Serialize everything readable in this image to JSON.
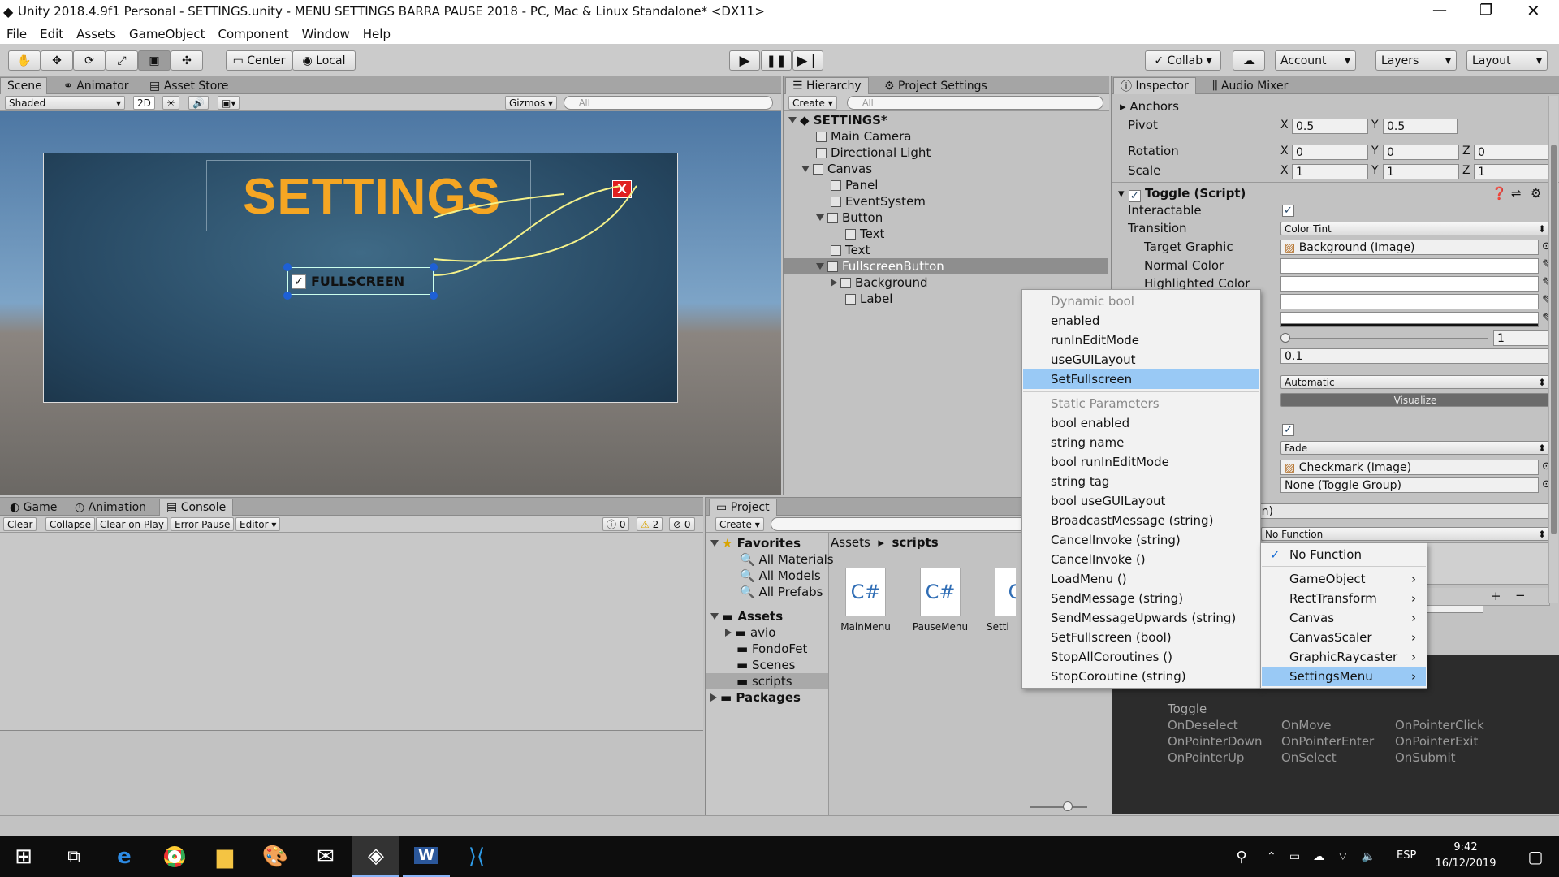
{
  "window": {
    "title": "Unity 2018.4.9f1 Personal - SETTINGS.unity - MENU SETTINGS BARRA PAUSE 2018 - PC, Mac & Linux Standalone* <DX11>"
  },
  "menu": [
    "File",
    "Edit",
    "Assets",
    "GameObject",
    "Component",
    "Window",
    "Help"
  ],
  "toolbar": {
    "center": "Center",
    "local": "Local",
    "collab": "Collab",
    "account": "Account",
    "layers": "Layers",
    "layout": "Layout"
  },
  "scene": {
    "tabs": [
      "Scene",
      "Animator",
      "Asset Store"
    ],
    "shading": "Shaded",
    "mode2d": "2D",
    "gizmos": "Gizmos",
    "search": "All",
    "canvas_title": "SETTINGS",
    "close_label": "X",
    "toggle_label": "FULLSCREEN"
  },
  "hierarchy": {
    "tabs": [
      "Hierarchy",
      "Project Settings"
    ],
    "create": "Create",
    "search": "All",
    "root": "SETTINGS*",
    "items": [
      {
        "label": "Main Camera"
      },
      {
        "label": "Directional Light"
      },
      {
        "label": "Canvas"
      },
      {
        "label": "Panel"
      },
      {
        "label": "EventSystem"
      },
      {
        "label": "Button"
      },
      {
        "label": "Text"
      },
      {
        "label": "Text"
      },
      {
        "label": "FullscreenButton"
      },
      {
        "label": "Background"
      },
      {
        "label": "Label"
      }
    ]
  },
  "inspector": {
    "tabs": [
      "Inspector",
      "Audio Mixer"
    ],
    "anchors": "Anchors",
    "pivot": "Pivot",
    "rotation": "Rotation",
    "scale": "Scale",
    "pivot_x": "0.5",
    "pivot_y": "0.5",
    "rot_x": "0",
    "rot_y": "0",
    "rot_z": "0",
    "scale_x": "1",
    "scale_y": "1",
    "scale_z": "1",
    "component": "Toggle (Script)",
    "interactable": "Interactable",
    "transition": "Transition",
    "transition_value": "Color Tint",
    "target_graphic": "Target Graphic",
    "target_graphic_value": "Background (Image)",
    "normal_color": "Normal Color",
    "highlighted_color": "Highlighted Color",
    "color_multiplier": "1",
    "fade_duration": "0.1",
    "navigation": "Automatic",
    "visualize": "Visualize",
    "toggle_transition": "Fade",
    "graphic": "Checkmark (Image)",
    "group": "None (Toggle Group)",
    "on_value_changed": "olean)",
    "no_function": "No Function",
    "events_title": "Toggle",
    "events": [
      "OnDeselect",
      "OnMove",
      "OnPointerClick",
      "OnPointerDown",
      "OnPointerEnter",
      "OnPointerExit",
      "OnPointerUp",
      "OnSelect",
      "OnSubmit"
    ]
  },
  "bottom_left": {
    "tabs": [
      "Game",
      "Animation",
      "Console"
    ],
    "buttons": [
      "Clear",
      "Collapse",
      "Clear on Play",
      "Error Pause",
      "Editor"
    ],
    "counts": {
      "info": "0",
      "warn": "2",
      "error": "0"
    }
  },
  "project": {
    "tab": "Project",
    "create": "Create",
    "favorites": "Favorites",
    "fav_items": [
      "All Materials",
      "All Models",
      "All Prefabs"
    ],
    "assets": "Assets",
    "asset_items": [
      "avio",
      "FondoFet",
      "Scenes",
      "scripts"
    ],
    "packages": "Packages",
    "breadcrumb": [
      "Assets",
      "scripts"
    ],
    "files": [
      {
        "icon": "C#",
        "name": "MainMenu"
      },
      {
        "icon": "C#",
        "name": "PauseMenu"
      },
      {
        "icon": "C",
        "name": "Setti"
      }
    ]
  },
  "function_menu": {
    "header_dynamic": "Dynamic bool",
    "dynamic": [
      "enabled",
      "runInEditMode",
      "useGUILayout",
      "SetFullscreen"
    ],
    "header_static": "Static Parameters",
    "static": [
      "bool enabled",
      "string name",
      "bool runInEditMode",
      "string tag",
      "bool useGUILayout",
      "BroadcastMessage (string)",
      "CancelInvoke (string)",
      "CancelInvoke ()",
      "LoadMenu ()",
      "SendMessage (string)",
      "SendMessageUpwards (string)",
      "SetFullscreen (bool)",
      "StopAllCoroutines ()",
      "StopCoroutine (string)"
    ]
  },
  "object_menu": {
    "items": [
      "No Function",
      "GameObject",
      "RectTransform",
      "Canvas",
      "CanvasScaler",
      "GraphicRaycaster",
      "SettingsMenu"
    ]
  },
  "taskbar": {
    "lang": "ESP",
    "time": "9:42",
    "date": "16/12/2019"
  },
  "colors": {
    "accent": "#f5a623",
    "selection": "#99c9f5",
    "scene_bg": "#2d4f68"
  }
}
